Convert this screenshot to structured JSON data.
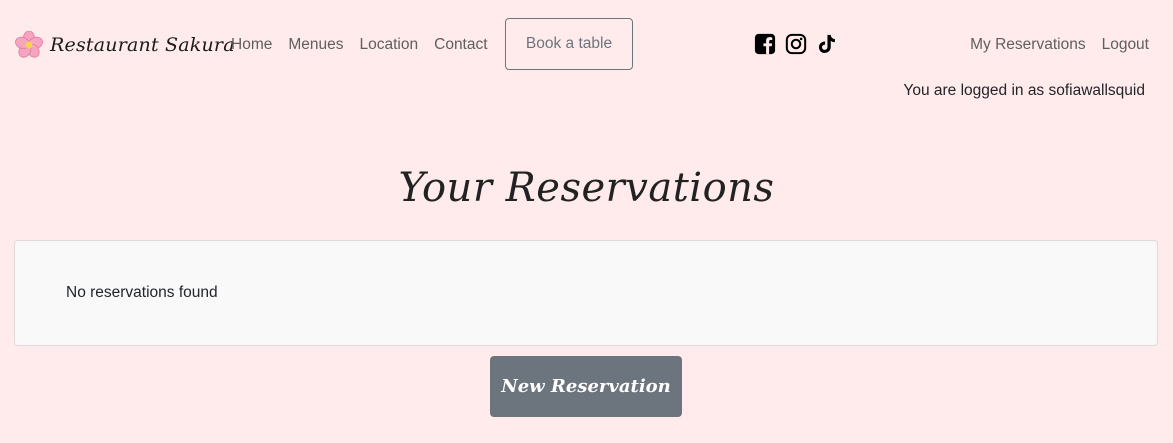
{
  "navbar": {
    "brand": "Restaurant Sakura",
    "links": [
      "Home",
      "Menues",
      "Location",
      "Contact"
    ],
    "book_button": "Book a table",
    "social_icons": [
      "facebook-square-icon",
      "instagram-icon",
      "tiktok-icon"
    ],
    "right_links": [
      "My Reservations",
      "Logout"
    ]
  },
  "user": {
    "logged_in_text": "You are logged in as sofiawallsquid"
  },
  "main": {
    "title": "Your Reservations",
    "empty_message": "No reservations found",
    "new_button": "New Reservation"
  },
  "colors": {
    "background": "#ffebeb",
    "button": "#6c757d",
    "card": "#f9f9f9"
  }
}
